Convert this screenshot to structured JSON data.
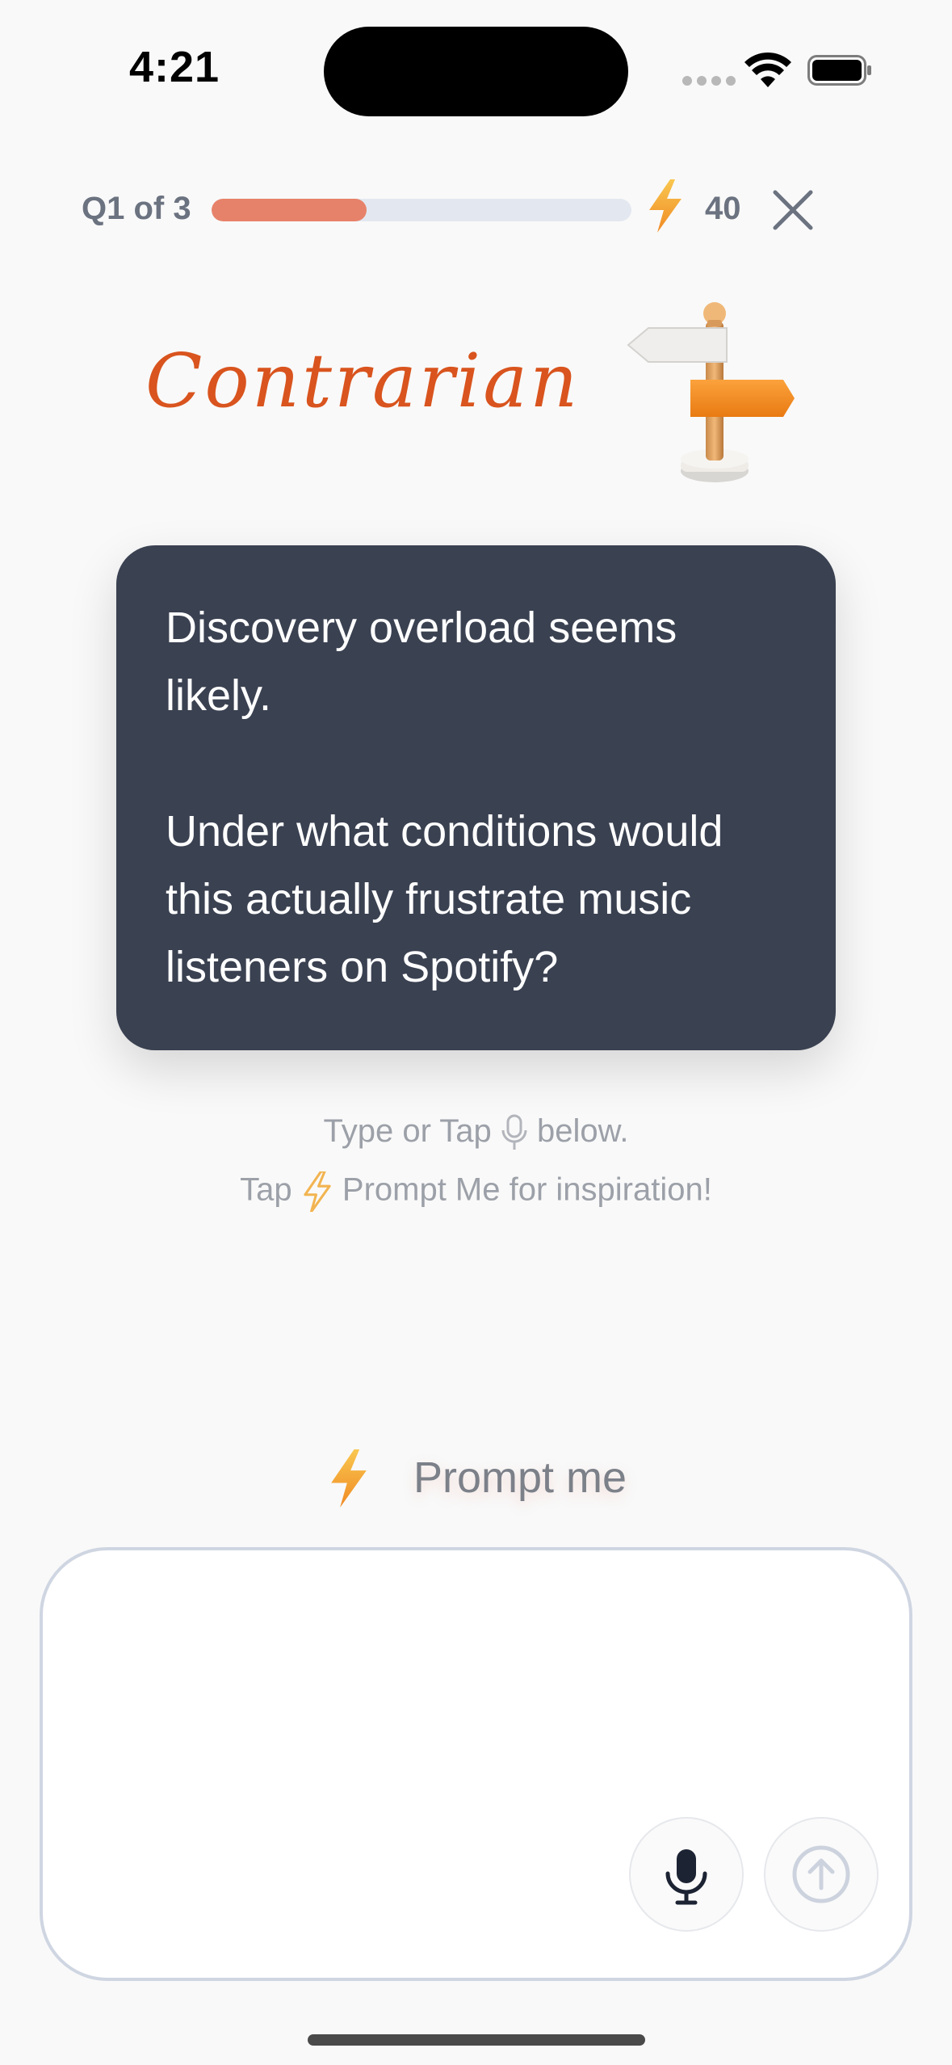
{
  "status_bar": {
    "time": "4:21"
  },
  "header": {
    "question_label": "Q1 of 3",
    "progress_fraction": 0.37,
    "points": "40",
    "accent_color": "#e7826a"
  },
  "mode": {
    "title": "Contrarian",
    "title_color": "#d9541e",
    "icon": "signpost-icon"
  },
  "question": {
    "line1": "Discovery overload seems likely.",
    "line2": "Under what conditions would this actually frustrate music listeners on Spotify?"
  },
  "hints": {
    "line1_before": "Type or Tap",
    "line1_after": "below.",
    "line2_before": "Tap",
    "line2_after": "Prompt Me for inspiration!"
  },
  "prompt_button": {
    "label": "Prompt me"
  },
  "composer": {
    "value": "",
    "placeholder": ""
  }
}
